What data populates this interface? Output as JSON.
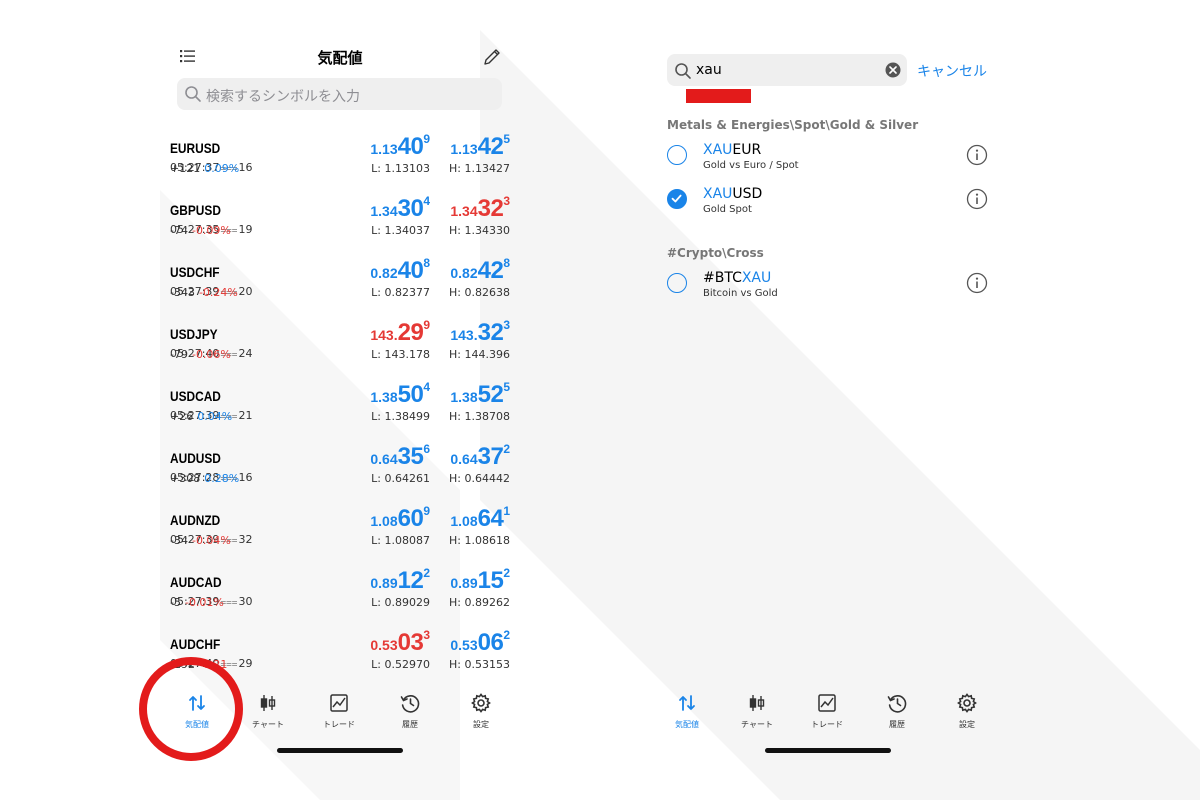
{
  "watchlist": {
    "title": "気配値",
    "search_placeholder": "検索するシンボルを入力",
    "rows": [
      {
        "change": "",
        "pct": "",
        "pct_color": "blue",
        "symbol": "EURUSD",
        "time": "05:27:37",
        "spread": "16",
        "bid": {
          "a": "1.13",
          "b": "40",
          "c": "9",
          "color": "blue"
        },
        "ask": {
          "a": "1.13",
          "b": "42",
          "c": "5",
          "color": "blue"
        },
        "low": "L: 1.13103",
        "high": "H: 1.13427"
      },
      {
        "change": "+121",
        "pct": "0.09%",
        "pct_color": "blue",
        "symbol": "GBPUSD",
        "time": "05:27:35",
        "spread": "19",
        "bid": {
          "a": "1.34",
          "b": "30",
          "c": "4",
          "color": "blue"
        },
        "ask": {
          "a": "1.34",
          "b": "32",
          "c": "3",
          "color": "red"
        },
        "low": "L: 1.34037",
        "high": "H: 1.34330"
      },
      {
        "change": "-74",
        "pct": "-0.09%",
        "pct_color": "red",
        "symbol": "USDCHF",
        "time": "05:27:39",
        "spread": "20",
        "bid": {
          "a": "0.82",
          "b": "40",
          "c": "8",
          "color": "blue"
        },
        "ask": {
          "a": "0.82",
          "b": "42",
          "c": "8",
          "color": "blue"
        },
        "low": "L: 0.82377",
        "high": "H: 0.82638"
      },
      {
        "change": "-343",
        "pct": "-0.24%",
        "pct_color": "red",
        "symbol": "USDJPY",
        "time": "05:27:40",
        "spread": "24",
        "bid": {
          "a": "143.",
          "b": "29",
          "c": "9",
          "color": "red"
        },
        "ask": {
          "a": "143.",
          "b": "32",
          "c": "3",
          "color": "blue"
        },
        "low": "L: 143.178",
        "high": "H: 144.396"
      },
      {
        "change": "-79",
        "pct": "-0.06%",
        "pct_color": "red",
        "symbol": "USDCAD",
        "time": "05:27:39",
        "spread": "21",
        "bid": {
          "a": "1.38",
          "b": "50",
          "c": "4",
          "color": "blue"
        },
        "ask": {
          "a": "1.38",
          "b": "52",
          "c": "5",
          "color": "blue"
        },
        "low": "L: 1.38499",
        "high": "H: 1.38708"
      },
      {
        "change": "+26",
        "pct": "0.04%",
        "pct_color": "blue",
        "symbol": "AUDUSD",
        "time": "05:27:28",
        "spread": "16",
        "bid": {
          "a": "0.64",
          "b": "35",
          "c": "6",
          "color": "blue"
        },
        "ask": {
          "a": "0.64",
          "b": "37",
          "c": "2",
          "color": "blue"
        },
        "low": "L: 0.64261",
        "high": "H: 0.64442"
      },
      {
        "change": "+308",
        "pct": "0.28%",
        "pct_color": "blue",
        "symbol": "AUDNZD",
        "time": "05:27:39",
        "spread": "32",
        "bid": {
          "a": "1.08",
          "b": "60",
          "c": "9",
          "color": "blue"
        },
        "ask": {
          "a": "1.08",
          "b": "64",
          "c": "1",
          "color": "blue"
        },
        "low": "L: 1.08087",
        "high": "H: 1.08618"
      },
      {
        "change": "-34",
        "pct": "-0.04%",
        "pct_color": "red",
        "symbol": "AUDCAD",
        "time": "05:27:39",
        "spread": "30",
        "bid": {
          "a": "0.89",
          "b": "12",
          "c": "2",
          "color": "blue"
        },
        "ask": {
          "a": "0.89",
          "b": "15",
          "c": "2",
          "color": "blue"
        },
        "low": "L: 0.89029",
        "high": "H: 0.89262"
      },
      {
        "change": "-5",
        "pct": "-0.01%",
        "pct_color": "red",
        "symbol": "AUDCHF",
        "time": "05:27:40",
        "spread": "29",
        "bid": {
          "a": "0.53",
          "b": "03",
          "c": "3",
          "color": "red"
        },
        "ask": {
          "a": "0.53",
          "b": "06",
          "c": "2",
          "color": "blue"
        },
        "low": "L: 0.52970",
        "high": "H: 0.53153"
      },
      {
        "change": "-192",
        "pct": "-0.21",
        "pct_color": "red",
        "symbol": "",
        "time": "",
        "spread": "",
        "bid": {
          "a": "",
          "b": "",
          "c": "",
          "color": "red"
        },
        "ask": {
          "a": "",
          "b": "",
          "c": "",
          "color": "blue"
        },
        "low": "",
        "high": ""
      }
    ]
  },
  "tabs": [
    {
      "label": "気配値",
      "icon": "quotes-arrows-icon",
      "active": true
    },
    {
      "label": "チャート",
      "icon": "candlestick-chart-icon",
      "active": false
    },
    {
      "label": "トレード",
      "icon": "trade-chart-icon",
      "active": false
    },
    {
      "label": "履歴",
      "icon": "history-clock-icon",
      "active": false
    },
    {
      "label": "設定",
      "icon": "settings-gear-icon",
      "active": false
    }
  ],
  "symbol_search": {
    "query": "xau",
    "cancel_label": "キャンセル",
    "groups": [
      {
        "title": "Metals & Energies\\Spot\\Gold & Silver",
        "items": [
          {
            "prefix": "",
            "match": "XAU",
            "suffix": "EUR",
            "desc": "Gold vs Euro / Spot",
            "selected": false
          },
          {
            "prefix": "",
            "match": "XAU",
            "suffix": "USD",
            "desc": "Gold Spot",
            "selected": true
          }
        ]
      },
      {
        "title": "#Crypto\\Cross",
        "items": [
          {
            "prefix": "#BTC",
            "match": "XAU",
            "suffix": "",
            "desc": "Bitcoin vs Gold",
            "selected": false
          }
        ]
      }
    ]
  },
  "colors": {
    "accent": "#1a84e8",
    "down": "#e53935",
    "highlight": "#e31b1b"
  }
}
